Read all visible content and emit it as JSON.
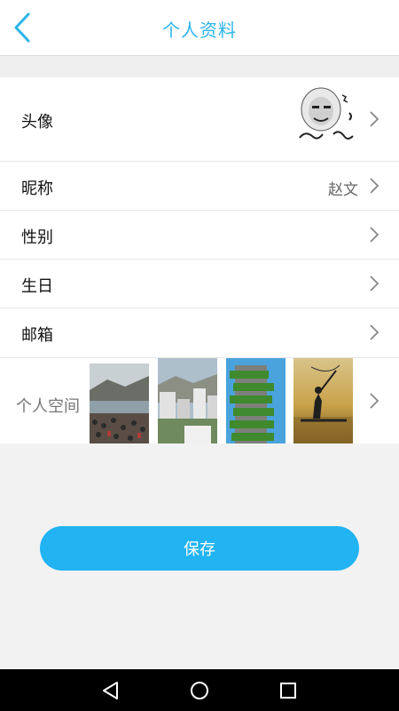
{
  "header": {
    "title": "个人资料",
    "back_icon": "chevron-left-icon",
    "accent_color": "#2bb5ea"
  },
  "rows": [
    {
      "key": "avatar",
      "label": "头像",
      "value": ""
    },
    {
      "key": "nickname",
      "label": "昵称",
      "value": "赵文"
    },
    {
      "key": "gender",
      "label": "性别",
      "value": ""
    },
    {
      "key": "birthday",
      "label": "生日",
      "value": ""
    },
    {
      "key": "email",
      "label": "邮箱",
      "value": ""
    },
    {
      "key": "space",
      "label": "个人空间",
      "value": ""
    }
  ],
  "space_photos": [
    "crowd-by-sea-photo",
    "city-buildings-photo",
    "green-tower-photo",
    "fisherman-sunset-photo"
  ],
  "save_button": {
    "label": "保存",
    "color": "#21b3f2"
  },
  "navbar": {
    "icons": [
      "back-triangle-icon",
      "home-circle-icon",
      "recents-square-icon"
    ]
  }
}
